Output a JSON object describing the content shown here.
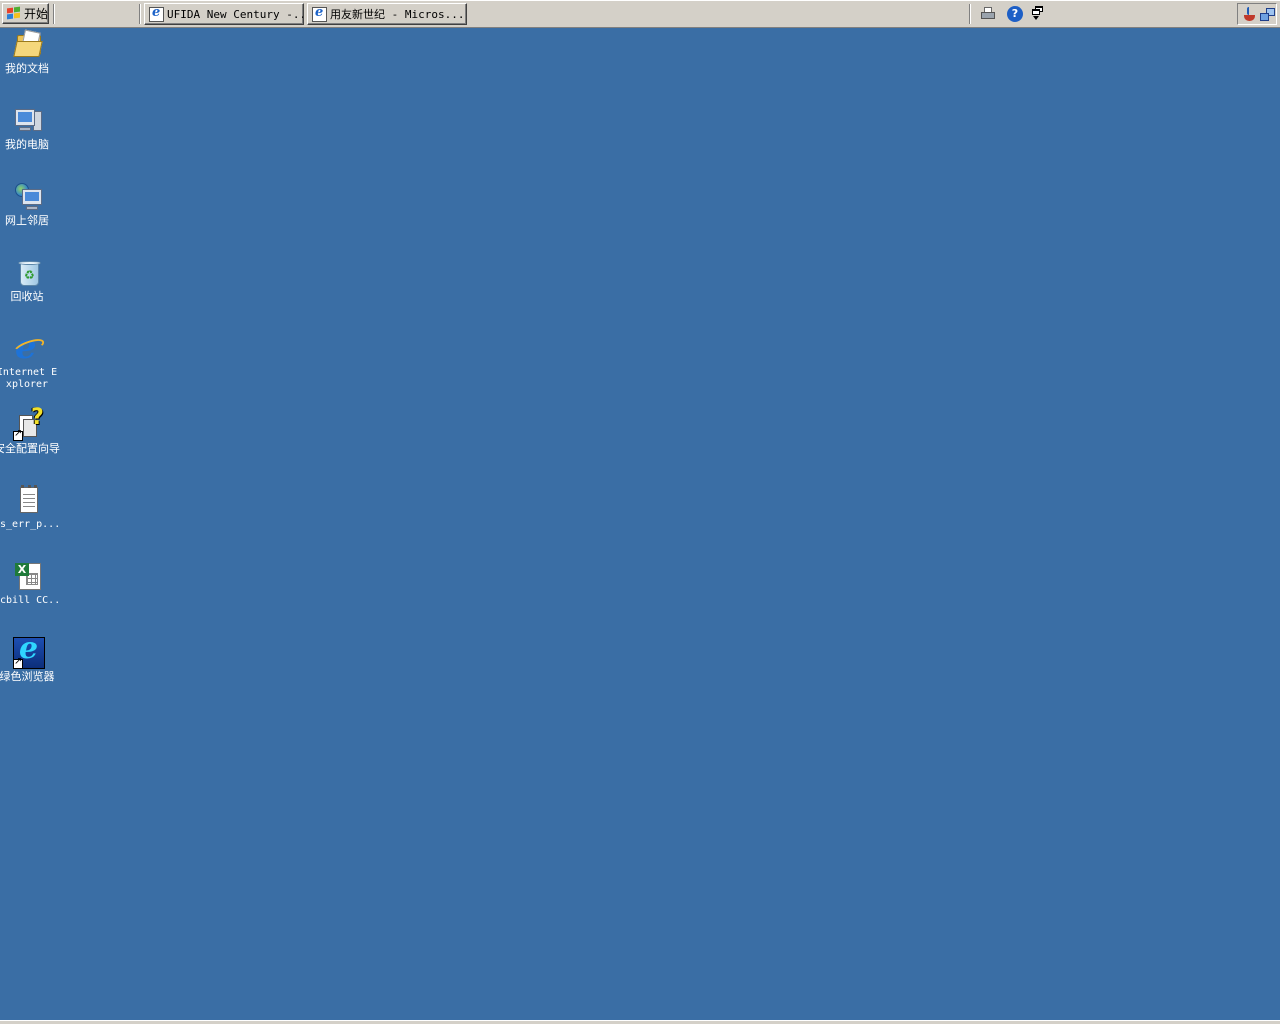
{
  "taskbar": {
    "start_label": "开始",
    "tasks": [
      {
        "label": "UFIDA New Century -...",
        "icon": "ie-page-icon"
      },
      {
        "label": "用友新世纪 - Micros...",
        "icon": "ie-page-icon"
      }
    ],
    "quick_icons": [
      "printer-icon",
      "help-icon",
      "windows-list-icon"
    ],
    "tray_icons": [
      "java-icon",
      "network-icon"
    ]
  },
  "desktop": {
    "background_color": "#3a6ea5",
    "icons": [
      {
        "label": "我的文档",
        "icon": "my-documents-icon"
      },
      {
        "label": "我的电脑",
        "icon": "my-computer-icon"
      },
      {
        "label": "网上邻居",
        "icon": "network-places-icon"
      },
      {
        "label": "回收站",
        "icon": "recycle-bin-icon"
      },
      {
        "label": "Internet Explorer",
        "icon": "internet-explorer-icon"
      },
      {
        "label": "安全配置向导",
        "icon": "security-wizard-icon"
      },
      {
        "label": "as_err_p...",
        "icon": "text-document-icon"
      },
      {
        "label": "Icbill CC...",
        "icon": "excel-file-icon"
      },
      {
        "label": "绿色浏览器",
        "icon": "green-browser-icon"
      }
    ]
  }
}
